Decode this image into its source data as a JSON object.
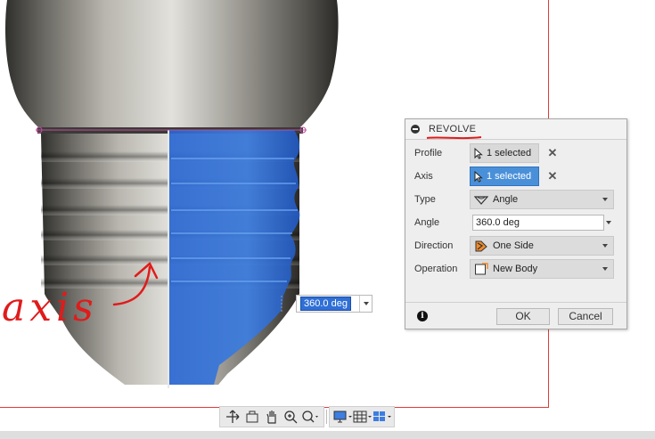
{
  "viewport": {
    "inline_angle_value": "360.0 deg",
    "annotation_text": "axis",
    "colors": {
      "profile_highlight": "#2f6fd6",
      "annotation": "#e01b1b",
      "border": "#e23b3b"
    }
  },
  "dialog": {
    "title": "REVOLVE",
    "rows": {
      "profile": {
        "label": "Profile",
        "value": "1 selected"
      },
      "axis": {
        "label": "Axis",
        "value": "1 selected"
      },
      "type": {
        "label": "Type",
        "value": "Angle"
      },
      "angle": {
        "label": "Angle",
        "value": "360.0 deg"
      },
      "direction": {
        "label": "Direction",
        "value": "One Side"
      },
      "operation": {
        "label": "Operation",
        "value": "New Body"
      }
    },
    "ok_label": "OK",
    "cancel_label": "Cancel"
  },
  "toolbar": {
    "icons": [
      "orbit-icon",
      "look-at-icon",
      "pan-icon",
      "zoom-icon",
      "fit-icon",
      "display-settings-icon",
      "grid-icon",
      "viewports-icon"
    ]
  }
}
